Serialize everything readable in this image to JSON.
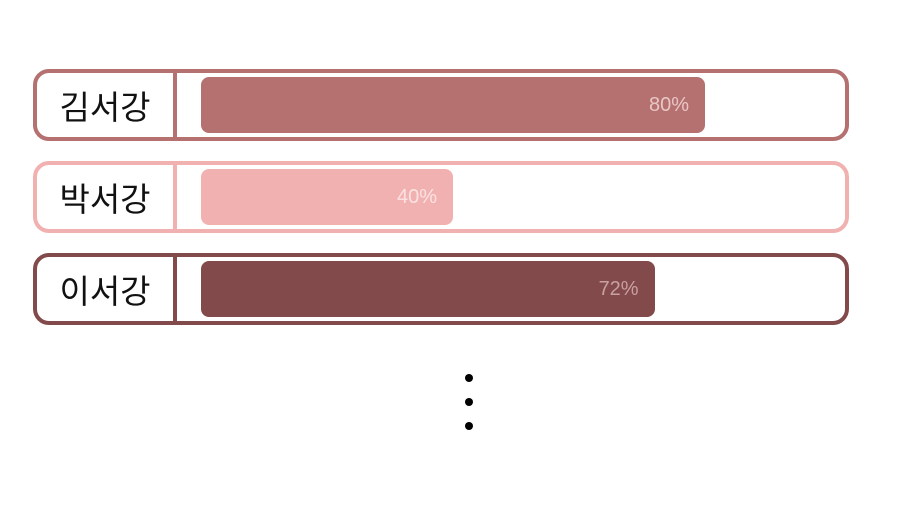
{
  "chart_data": {
    "type": "bar",
    "orientation": "horizontal",
    "categories": [
      "김서강",
      "박서강",
      "이서강"
    ],
    "values": [
      80,
      40,
      72
    ],
    "value_labels": [
      "80%",
      "40%",
      "72%"
    ],
    "xlim": [
      0,
      100
    ],
    "colors": [
      "#b57070",
      "#f2b1b1",
      "#824a4a"
    ],
    "value_text_colors": [
      "#e9c6c6",
      "#fbe2e2",
      "#c9a0a0"
    ],
    "continuation": "more rows omitted (vertical ellipsis)"
  }
}
